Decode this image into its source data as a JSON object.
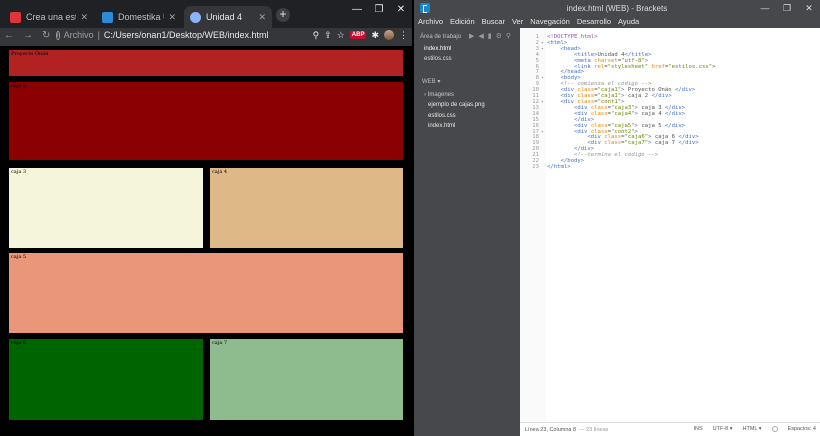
{
  "chrome": {
    "tabs": [
      {
        "label": "Crea una estructura",
        "close": "✕",
        "favicon_color": "#e0343a"
      },
      {
        "label": "Domestika Unidad",
        "close": "✕",
        "favicon_color": "#2e8bd8"
      },
      {
        "label": "Unidad 4",
        "close": "✕",
        "favicon_color": "#8ab4f8"
      }
    ],
    "new_tab": "+",
    "window_controls": [
      "—",
      "❐",
      "✕"
    ],
    "nav": {
      "back": "←",
      "forward": "→",
      "reload": "↻"
    },
    "omnibox": {
      "info": "i",
      "scheme": "Archivo",
      "separator": "|",
      "url": "C:/Users/onan1/Desktop/WEB/index.html"
    },
    "toolbar_icons": {
      "search": "⚲",
      "share": "⇪",
      "bookmark": "☆",
      "adblock": "ABP",
      "extensions": "✱",
      "menu": "⋮"
    },
    "page": {
      "boxes": [
        {
          "label": "Proyecto Onán",
          "color": "#b22222"
        },
        {
          "label": "caja 2",
          "color": "#8b0000"
        },
        {
          "label": "caja 3",
          "color": "#f5f5dc"
        },
        {
          "label": "caja 4",
          "color": "#deb887"
        },
        {
          "label": "caja 5",
          "color": "#e9967a"
        },
        {
          "label": "caja 6",
          "color": "#006400"
        },
        {
          "label": "caja 7",
          "color": "#8fbc8f"
        }
      ]
    }
  },
  "brackets": {
    "title": "index.html (WEB) - Brackets",
    "window_controls": [
      "—",
      "❐",
      "✕"
    ],
    "menu": [
      "Archivo",
      "Edición",
      "Buscar",
      "Ver",
      "Navegación",
      "Desarrollo",
      "Ayuda"
    ],
    "sidebar": {
      "working_files_label": "Área de trabajo",
      "working_files": [
        "index.html",
        "estilos.css"
      ],
      "project_label": "WEB ▾",
      "folder": "› Imagenes",
      "files": [
        "ejemplo de cajas.png",
        "estilos.css",
        "index.html"
      ]
    },
    "status": {
      "position": "Línea 23, Columna 8",
      "lines": "— 23 líneas",
      "ins": "INS",
      "encoding": "UTF-8 ▾",
      "mode": "HTML ▾",
      "spaces": "Espacios: 4"
    },
    "code_lines": [
      "<!DOCTYPE html>",
      "<html>",
      "    <head>",
      "        <title>Unidad 4</title>",
      "        <meta charset=\"utf-8\">",
      "        <link rel=\"stylesheet\" href=\"estilos.css\">",
      "    </head>",
      "    <body>",
      "    <!-- comienza el código -->",
      "    <div class=\"caja1\"> Proyecto Onán </div>",
      "    <div class=\"caja1\"> caja 2 </div>",
      "    <div class=\"cont1\">",
      "        <div class=\"caja3\"> caja 3 </div>",
      "        <div class=\"caja4\"> caja 4 </div>",
      "        </div>",
      "        <div class=\"caja5\"> caja 5 </div>",
      "        <div class=\"cont2\">",
      "            <div class=\"caja6\"> caja 6 </div>",
      "            <div class=\"caja7\"> caja 7 </div>",
      "        </div>",
      "        <!--termina el código -->",
      "    </body>",
      "</html>"
    ]
  }
}
